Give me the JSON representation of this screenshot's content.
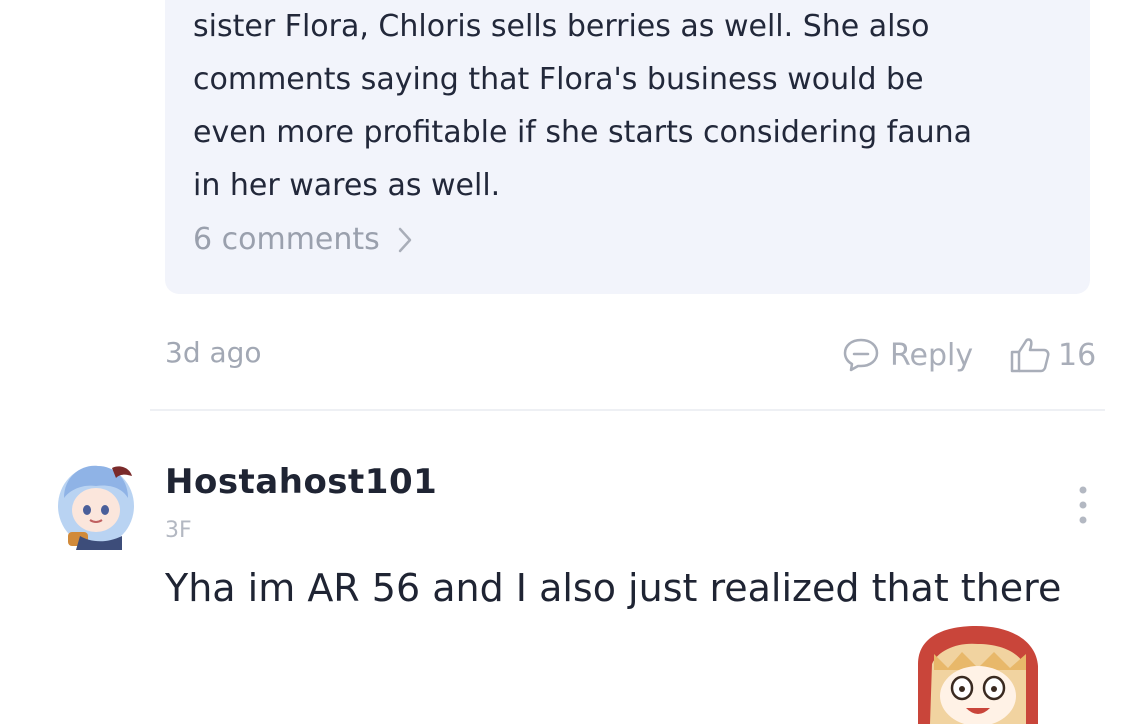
{
  "parent_comment": {
    "quoted_reply": {
      "text": "sister Flora, Chloris sells berries as well. She also\ncomments saying that Flora's business would be\neven more profitable if she starts considering fauna\nin her wares as well.",
      "comments_link": "6 comments",
      "link_icon": "chevron-right-icon"
    },
    "time": "3d ago",
    "reply_label": "Reply",
    "like_count": "16"
  },
  "comment": {
    "username": "Hostahost101",
    "floor": "3F",
    "text": "Yha im AR 56 and I also just realized that there"
  },
  "colors": {
    "quote_background": "#f2f4fb",
    "muted_text": "#a2a8b4",
    "primary_text": "#1f2433"
  }
}
